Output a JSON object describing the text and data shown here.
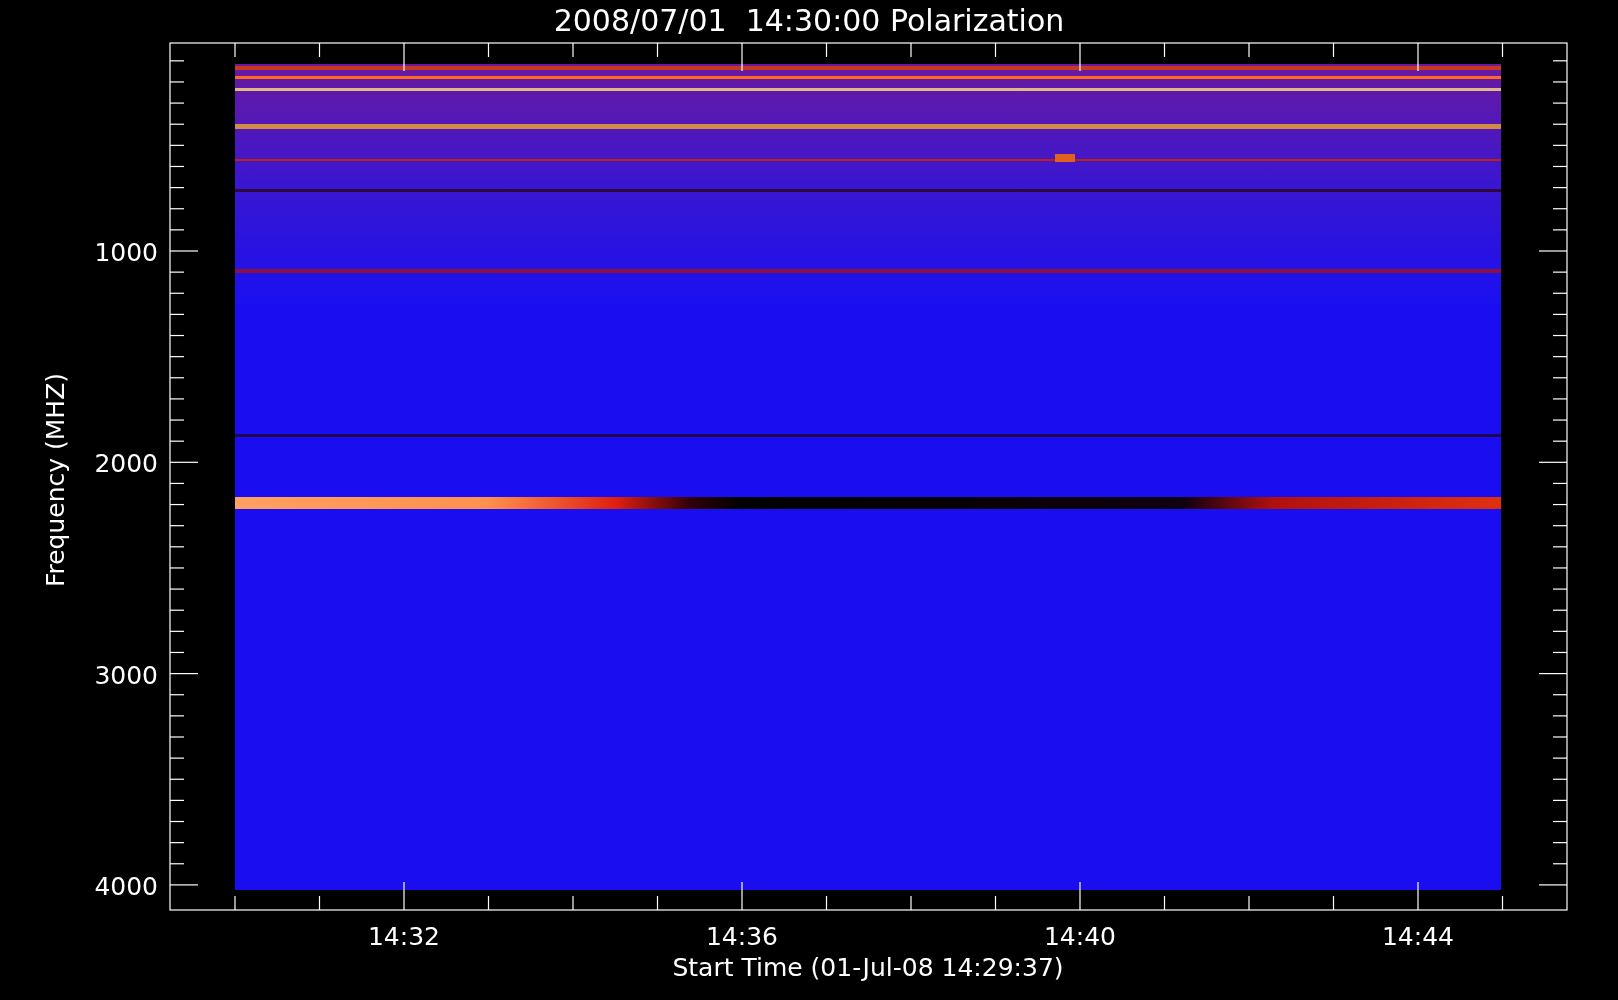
{
  "title": "2008/07/01  14:30:00 Polarization",
  "ylabel": "Frequency (MHZ)",
  "xlabel": "Start Time (01-Jul-08 14:29:37)",
  "yticks": [
    "1000",
    "2000",
    "3000",
    "4000"
  ],
  "xticks": [
    "14:32",
    "14:36",
    "14:40",
    "14:44"
  ]
}
